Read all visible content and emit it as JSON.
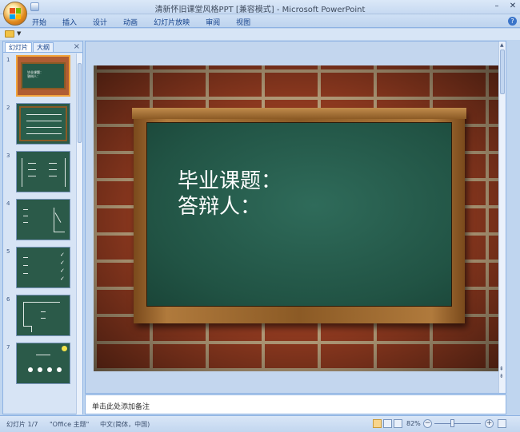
{
  "window": {
    "title": "清新怀旧课堂风格PPT [兼容模式] - Microsoft PowerPoint",
    "minimize": "–",
    "close": "✕"
  },
  "ribbon": {
    "tabs": [
      "开始",
      "插入",
      "设计",
      "动画",
      "幻灯片放映",
      "审阅",
      "视图"
    ]
  },
  "left_panel": {
    "tab_slides": "幻灯片",
    "tab_outline": "大纲",
    "close": "×",
    "slides": [
      {
        "num": "1",
        "selected": true
      },
      {
        "num": "2",
        "selected": false
      },
      {
        "num": "3",
        "selected": false
      },
      {
        "num": "4",
        "selected": false
      },
      {
        "num": "5",
        "selected": false
      },
      {
        "num": "6",
        "selected": false
      },
      {
        "num": "7",
        "selected": false
      }
    ]
  },
  "slide": {
    "line1": "毕业课题：",
    "line2": "答辩人："
  },
  "notes": {
    "placeholder": "单击此处添加备注"
  },
  "status": {
    "slide_counter": "幻灯片 1/7",
    "theme": "\"Office 主题\"",
    "language": "中文(简体，中国)",
    "zoom": "82%"
  },
  "colors": {
    "chalkboard": "#215344",
    "brick": "#9a3e22",
    "frame": "#8b5a25",
    "ribbon": "#bfd5ef"
  }
}
